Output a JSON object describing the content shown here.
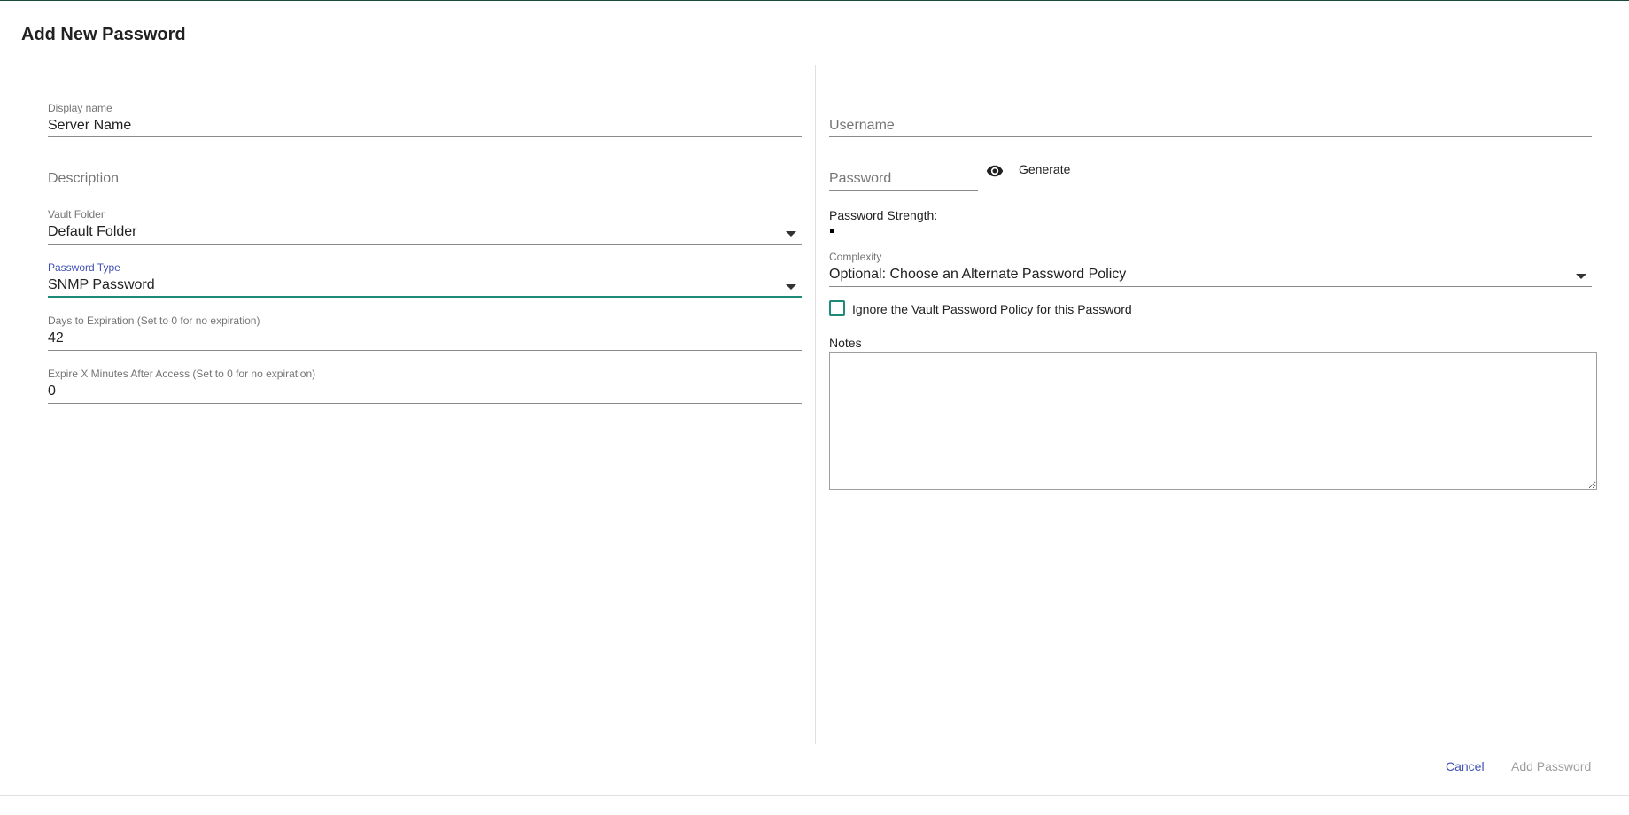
{
  "dialog": {
    "title": "Add New Password"
  },
  "left": {
    "display_name": {
      "label": "Display name",
      "value": "Server Name"
    },
    "description": {
      "placeholder": "Description"
    },
    "vault_folder": {
      "label": "Vault Folder",
      "value": "Default Folder"
    },
    "password_type": {
      "label": "Password Type",
      "value": "SNMP Password"
    },
    "days_to_expiration": {
      "label": "Days to Expiration (Set to 0 for no expiration)",
      "value": "42"
    },
    "expire_minutes": {
      "label": "Expire X Minutes After Access (Set to 0 for no expiration)",
      "value": "0"
    }
  },
  "right": {
    "username": {
      "placeholder": "Username"
    },
    "password": {
      "placeholder": "Password"
    },
    "generate_label": "Generate",
    "strength_label": "Password Strength:",
    "complexity": {
      "label": "Complexity",
      "value": "Optional: Choose an Alternate Password Policy"
    },
    "ignore_policy_label": "Ignore the Vault Password Policy for this Password",
    "notes_label": "Notes"
  },
  "actions": {
    "cancel_label": "Cancel",
    "add_label": "Add Password"
  },
  "icons": {
    "visibility": "eye-icon",
    "dropdown": "caret-down-icon"
  },
  "colors": {
    "accent_teal": "#1e8a78",
    "primary_indigo": "#3f51b5",
    "disabled": "#9e9e9e"
  }
}
